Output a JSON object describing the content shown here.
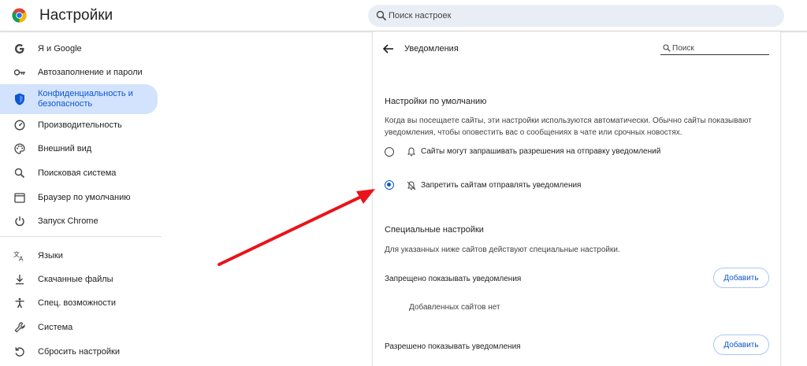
{
  "header": {
    "title": "Настройки",
    "search_placeholder": "Поиск настроек"
  },
  "sidebar": {
    "items": [
      {
        "label": "Я и Google",
        "icon": "google-g-icon",
        "active": false
      },
      {
        "label": "Автозаполнение и пароли",
        "icon": "key-icon",
        "active": false
      },
      {
        "label_line1": "Конфиденциальность и",
        "label_line2": "безопасность",
        "icon": "shield-icon",
        "active": true
      },
      {
        "label": "Производительность",
        "icon": "speedometer-icon",
        "active": false
      },
      {
        "label": "Внешний вид",
        "icon": "palette-icon",
        "active": false
      },
      {
        "label": "Поисковая система",
        "icon": "search-icon",
        "active": false
      },
      {
        "label": "Браузер по умолчанию",
        "icon": "browser-window-icon",
        "active": false
      },
      {
        "label": "Запуск Chrome",
        "icon": "power-icon",
        "active": false
      },
      {
        "label": "Языки",
        "icon": "translate-icon",
        "active": false
      },
      {
        "label": "Скачанные файлы",
        "icon": "download-icon",
        "active": false
      },
      {
        "label": "Спец. возможности",
        "icon": "accessibility-icon",
        "active": false
      },
      {
        "label": "Система",
        "icon": "wrench-icon",
        "active": false
      },
      {
        "label": "Сбросить настройки",
        "icon": "reset-icon",
        "active": false
      }
    ]
  },
  "content": {
    "page_title": "Уведомления",
    "search_placeholder": "Поиск",
    "default_section": {
      "title": "Настройки по умолчанию",
      "desc_line1": "Когда вы посещаете сайты, эти настройки используются автоматически. Обычно сайты показывают",
      "desc_line2": "уведомления, чтобы оповестить вас о сообщениях в чате или срочных новостях.",
      "options": [
        {
          "label": "Сайты могут запрашивать разрешения на отправку уведомлений",
          "icon": "bell-icon",
          "checked": false
        },
        {
          "label": "Запретить сайтам отправлять уведомления",
          "icon": "bell-off-icon",
          "checked": true
        }
      ]
    },
    "custom_section": {
      "title": "Специальные настройки",
      "desc": "Для указанных ниже сайтов действуют специальные настройки.",
      "blocked_label": "Запрещено показывать уведомления",
      "blocked_add": "Добавить",
      "blocked_empty": "Добавленных сайтов нет",
      "allowed_label": "Разрешено показывать уведомления",
      "allowed_add": "Добавить"
    }
  },
  "colors": {
    "accent": "#0b57d0",
    "active_bg": "#d3e3fd",
    "annotation_arrow": "#e8141a"
  }
}
